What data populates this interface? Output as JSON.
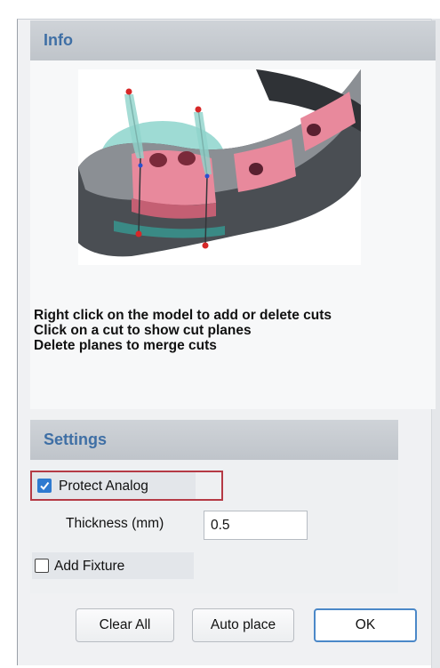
{
  "info": {
    "title": "Info",
    "instructions": [
      "Right click on the model to add or delete cuts",
      "Click on a cut to show cut planes",
      "Delete planes to merge cuts"
    ]
  },
  "settings": {
    "title": "Settings",
    "protect_analog": {
      "label": "Protect Analog",
      "checked": true
    },
    "thickness": {
      "label": "Thickness (mm)",
      "value": "0.5"
    },
    "add_fixture": {
      "label": "Add Fixture",
      "checked": false
    }
  },
  "buttons": {
    "clear_all": "Clear All",
    "auto_place": "Auto place",
    "ok": "OK"
  },
  "colors": {
    "header_text": "#3f6fa5",
    "highlight_border": "#b53a45",
    "checkbox_checked": "#2e7ad0",
    "model_gray": "#4a4e53",
    "model_pink": "#e8899c",
    "plane_teal": "#7ecfc6"
  }
}
